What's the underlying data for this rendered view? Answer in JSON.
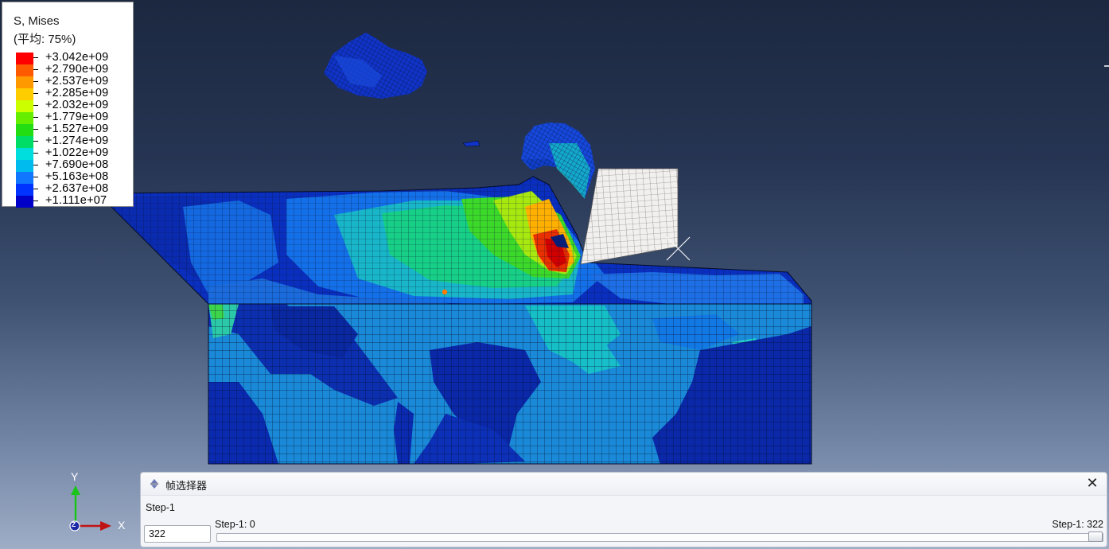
{
  "legend": {
    "title": "S, Mises",
    "subtitle": "(平均: 75%)",
    "entries": [
      {
        "label": "+3.042e+09",
        "color": "#ff0000"
      },
      {
        "label": "+2.790e+09",
        "color": "#ff5a00"
      },
      {
        "label": "+2.537e+09",
        "color": "#ff9900"
      },
      {
        "label": "+2.285e+09",
        "color": "#ffcc00"
      },
      {
        "label": "+2.032e+09",
        "color": "#ccff00"
      },
      {
        "label": "+1.779e+09",
        "color": "#66ee00"
      },
      {
        "label": "+1.527e+09",
        "color": "#22dd11"
      },
      {
        "label": "+1.274e+09",
        "color": "#00dd66"
      },
      {
        "label": "+1.022e+09",
        "color": "#00dddd"
      },
      {
        "label": "+7.690e+08",
        "color": "#00bbee"
      },
      {
        "label": "+5.163e+08",
        "color": "#1177ff"
      },
      {
        "label": "+2.637e+08",
        "color": "#0033ff"
      },
      {
        "label": "+1.111e+07",
        "color": "#0000c8"
      }
    ]
  },
  "triad": {
    "y_label": "Y",
    "x_label": "X",
    "z_label": "Z"
  },
  "frame_selector": {
    "title": "帧选择器",
    "step_label": "Step-1",
    "frame_value": "322",
    "min_label": "Step-1: 0",
    "max_label": "Step-1: 322",
    "slider_fraction": 1.0
  }
}
